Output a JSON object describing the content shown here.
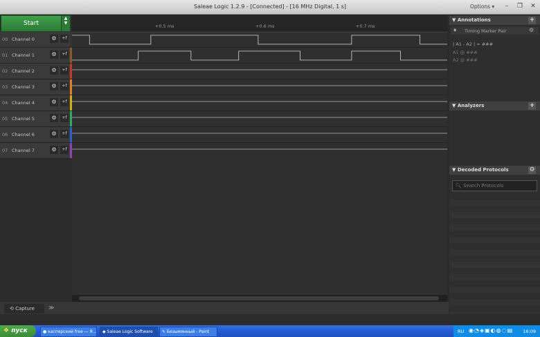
{
  "window": {
    "title": "Saleae Logic 1.2.9 - [Connected] - [16 MHz Digital, 1 s]",
    "options": "Options ▾"
  },
  "toolbar": {
    "start_label": "Start"
  },
  "time_ruler": {
    "ticks": [
      "+0.5 ms",
      "+0.6 ms",
      "+0.7 ms"
    ]
  },
  "channels": [
    {
      "num": "00",
      "name": "Channel 0",
      "color": "#333333"
    },
    {
      "num": "01",
      "name": "Channel 1",
      "color": "#8a5a2a"
    },
    {
      "num": "02",
      "name": "Channel 2",
      "color": "#c0392b"
    },
    {
      "num": "03",
      "name": "Channel 3",
      "color": "#e67e22"
    },
    {
      "num": "04",
      "name": "Channel 4",
      "color": "#d4b012"
    },
    {
      "num": "05",
      "name": "Channel 5",
      "color": "#27ae60"
    },
    {
      "num": "06",
      "name": "Channel 6",
      "color": "#2e5fd0"
    },
    {
      "num": "07",
      "name": "Channel 7",
      "color": "#8e44ad"
    }
  ],
  "waveforms": {
    "ch0_edges_ms": [
      0.4333,
      0.4944,
      0.6013,
      0.6944,
      0.7625,
      0.8056
    ],
    "ch1_edges_ms": [
      0.4819,
      0.5344,
      0.5819,
      0.6431,
      0.6944,
      0.7431,
      0.7931
    ]
  },
  "bottom": {
    "capture_tab": "Capture"
  },
  "annotations": {
    "header": "Annotations",
    "marker": "Timing Marker Pair",
    "line1": "| A1 - A2 | = ###",
    "line2": "A1  @  ###",
    "line3": "A2  @  ###"
  },
  "analyzers": {
    "header": "Analyzers"
  },
  "decoded": {
    "header": "Decoded Protocols",
    "search_placeholder": "Search Protocols"
  },
  "taskbar": {
    "start": "пуск",
    "tasks": [
      "касперский free — Я...",
      "Saleae Logic Software",
      "Безымянный - Paint"
    ],
    "lang": "RU",
    "clock": "16:09"
  }
}
